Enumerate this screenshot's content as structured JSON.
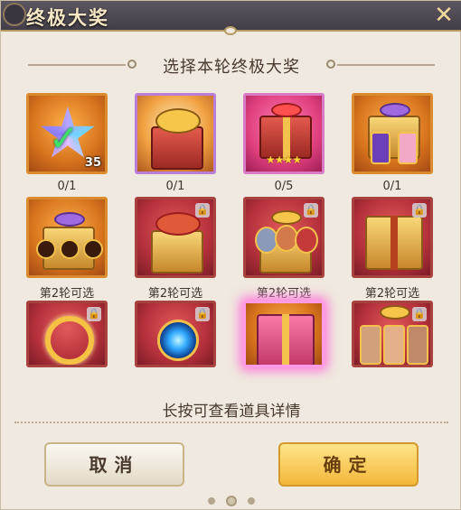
{
  "dialog": {
    "title": "终极大奖",
    "close_icon": "close-icon",
    "subtitle": "选择本轮终极大奖",
    "hint": "长按可查看道具详情"
  },
  "rewards": [
    {
      "name": "star-crystal-reward",
      "label": "0/1",
      "count": "35",
      "state": "selected-check"
    },
    {
      "name": "gold-coin-chest",
      "label": "0/1"
    },
    {
      "name": "red-gift-box",
      "label": "0/5",
      "stars": "★★★★"
    },
    {
      "name": "card-gift-box",
      "label": "0/1"
    },
    {
      "name": "emblem-gift-box",
      "label": "第2轮可选",
      "locked": true
    },
    {
      "name": "red-coin-chest",
      "label": "第2轮可选",
      "locked": true
    },
    {
      "name": "portrait-gift-box",
      "label": "第2轮可选",
      "locked": true
    },
    {
      "name": "gold-treasure-chest",
      "label": "第2轮可选",
      "locked": true
    },
    {
      "name": "golden-ring-item",
      "label": "",
      "locked": true
    },
    {
      "name": "blue-orb-item",
      "label": "",
      "locked": true
    },
    {
      "name": "pink-treasure-chest",
      "label": "",
      "selected": true
    },
    {
      "name": "hero-portrait-box",
      "label": "",
      "locked": true
    }
  ],
  "buttons": {
    "cancel_label": "取消",
    "confirm_label": "确定"
  },
  "colors": {
    "accent_gold": "#f3b83a",
    "panel_bg": "#efe9df",
    "title_bar": "#4a454f",
    "selection_glow": "#ff7ad9"
  }
}
